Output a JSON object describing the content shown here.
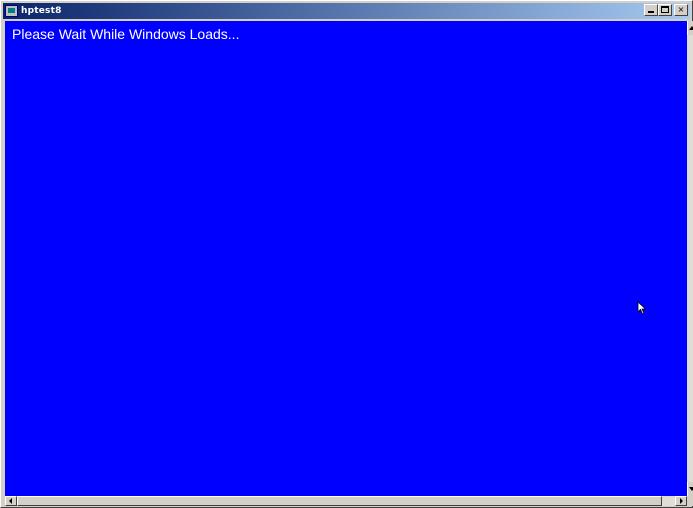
{
  "window": {
    "title": "hptest8",
    "buttons": {
      "minimize_icon": "minimize-icon",
      "maximize_icon": "maximize-icon",
      "close_glyph": "×"
    }
  },
  "screen": {
    "message": "Please Wait While Windows Loads...",
    "background_color": "#0000ff",
    "text_color": "#ffffff"
  },
  "cursor": {
    "icon": "mouse-pointer-icon"
  }
}
